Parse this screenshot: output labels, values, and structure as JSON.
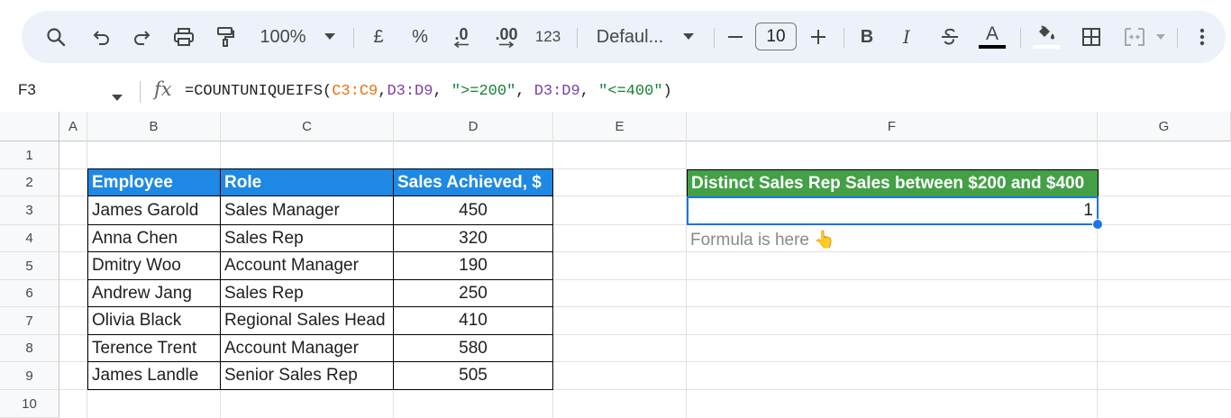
{
  "toolbar": {
    "zoom": "100%",
    "currency": "£",
    "percent": "%",
    "decrease_decimal": ".0",
    "increase_decimal": ".00",
    "number_format": "123",
    "font_name": "Defaul...",
    "font_size": "10",
    "bold": "B",
    "italic": "I",
    "text_color": "A",
    "icons": [
      "search-icon",
      "undo-icon",
      "redo-icon",
      "print-icon",
      "paint-format-icon",
      "chevron-down-icon",
      "minus-icon",
      "plus-icon",
      "strikethrough-icon",
      "fill-color-icon",
      "borders-icon",
      "merge-cells-icon",
      "more-vert-icon"
    ]
  },
  "formula_bar": {
    "name_box": "F3",
    "fx": "fx",
    "formula_parts": [
      {
        "text": "=COUNTUNIQUEIFS(",
        "color": "#1f1f1f"
      },
      {
        "text": "C3:C9",
        "color": "#e8710a"
      },
      {
        "text": ",",
        "color": "#1f1f1f"
      },
      {
        "text": "D3:D9",
        "color": "#7b3fa8"
      },
      {
        "text": ", ",
        "color": "#1f1f1f"
      },
      {
        "text": "\">=200\"",
        "color": "#188038"
      },
      {
        "text": ", ",
        "color": "#1f1f1f"
      },
      {
        "text": "D3:D9",
        "color": "#7b3fa8"
      },
      {
        "text": ", ",
        "color": "#1f1f1f"
      },
      {
        "text": "\"<=400\"",
        "color": "#188038"
      },
      {
        "text": ")",
        "color": "#1f1f1f"
      }
    ]
  },
  "columns": [
    "A",
    "B",
    "C",
    "D",
    "E",
    "F",
    "G"
  ],
  "rows": [
    "1",
    "2",
    "3",
    "4",
    "5",
    "6",
    "7",
    "8",
    "9",
    "10"
  ],
  "table": {
    "headers": [
      "Employee",
      "Role",
      "Sales Achieved, $"
    ],
    "rows": [
      [
        "James Garold",
        "Sales Manager",
        "450"
      ],
      [
        "Anna Chen",
        "Sales Rep",
        "320"
      ],
      [
        "Dmitry Woo",
        "Account Manager",
        "190"
      ],
      [
        "Andrew Jang",
        "Sales Rep",
        "250"
      ],
      [
        "Olivia Black",
        "Regional Sales Head",
        "410"
      ],
      [
        "Terence Trent",
        "Account Manager",
        "580"
      ],
      [
        "James Landle",
        "Senior Sales Rep",
        "505"
      ]
    ],
    "header_color": "#1e88e5"
  },
  "result": {
    "header": "Distinct Sales Rep Sales between $200 and $400",
    "value": "1",
    "note": "Formula is here 👆",
    "header_color": "#43a047"
  }
}
